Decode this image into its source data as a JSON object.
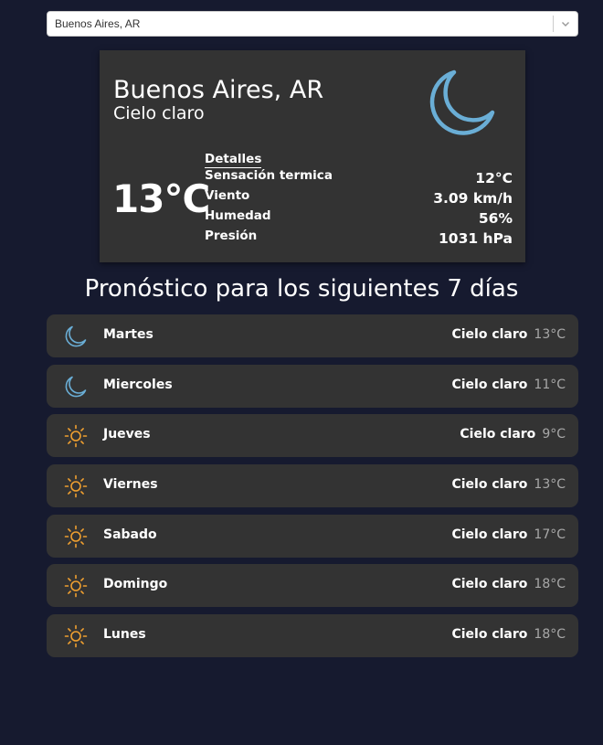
{
  "search": {
    "value": "Buenos Aires, AR"
  },
  "current": {
    "city": "Buenos Aires, AR",
    "description": "Cielo claro",
    "temperature": "13°C",
    "icon": "moon-icon",
    "details_title": "Detalles",
    "details": [
      {
        "label": "Sensación termica",
        "value": "12°C"
      },
      {
        "label": "Viento",
        "value": "3.09 km/h"
      },
      {
        "label": "Humedad",
        "value": "56%"
      },
      {
        "label": "Presión",
        "value": "1031 hPa"
      }
    ]
  },
  "forecast": {
    "title": "Pronóstico para los siguientes 7 días",
    "days": [
      {
        "day": "Martes",
        "description": "Cielo claro",
        "temperature": "13°C",
        "icon": "moon-icon"
      },
      {
        "day": "Miercoles",
        "description": "Cielo claro",
        "temperature": "11°C",
        "icon": "moon-icon"
      },
      {
        "day": "Jueves",
        "description": "Cielo claro",
        "temperature": "9°C",
        "icon": "sun-icon"
      },
      {
        "day": "Viernes",
        "description": "Cielo claro",
        "temperature": "13°C",
        "icon": "sun-icon"
      },
      {
        "day": "Sabado",
        "description": "Cielo claro",
        "temperature": "17°C",
        "icon": "sun-icon"
      },
      {
        "day": "Domingo",
        "description": "Cielo claro",
        "temperature": "18°C",
        "icon": "sun-icon"
      },
      {
        "day": "Lunes",
        "description": "Cielo claro",
        "temperature": "18°C",
        "icon": "sun-icon"
      }
    ]
  },
  "colors": {
    "background": "#161a2f",
    "card": "#333333",
    "moon": "#6aaed6",
    "sun": "#f0a030",
    "muted_temp": "#a8a8a8"
  }
}
